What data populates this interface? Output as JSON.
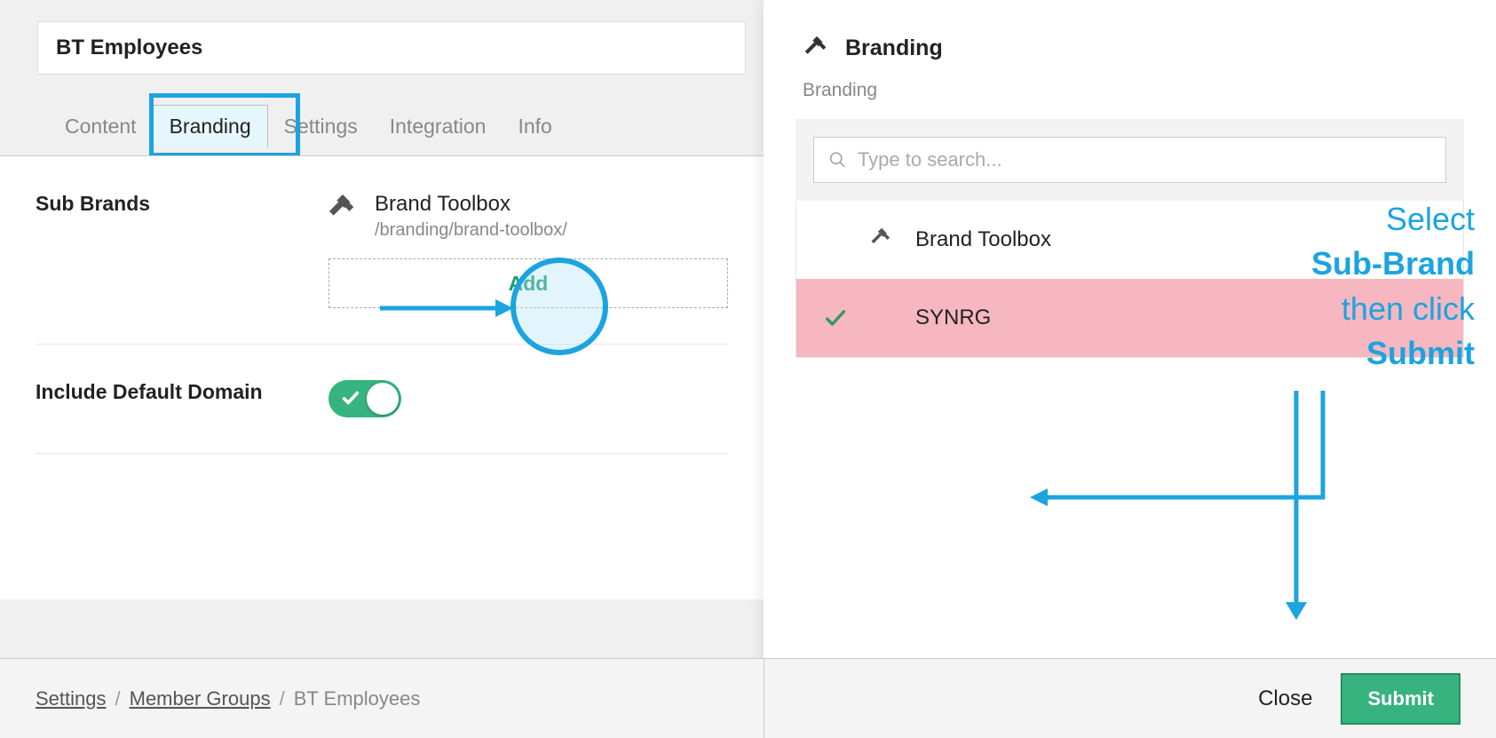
{
  "header": {
    "title_value": "BT Employees"
  },
  "tabs": {
    "content": "Content",
    "branding": "Branding",
    "settings": "Settings",
    "integration": "Integration",
    "info": "Info",
    "active": "branding"
  },
  "subbrands": {
    "label": "Sub Brands",
    "item_name": "Brand Toolbox",
    "item_path": "/branding/brand-toolbox/",
    "add_label": "Add"
  },
  "default_domain": {
    "label": "Include Default Domain",
    "value": true
  },
  "right_panel": {
    "title": "Branding",
    "subtitle": "Branding",
    "search_placeholder": "Type to search...",
    "list": [
      {
        "label": "Brand Toolbox",
        "selected": false
      },
      {
        "label": "SYNRG",
        "selected": true
      }
    ]
  },
  "annotation": {
    "line1": "Select",
    "line2": "Sub-Brand",
    "line3": "then click",
    "line4": "Submit"
  },
  "footer": {
    "crumbs": {
      "settings": "Settings",
      "member_groups": "Member Groups",
      "current": "BT Employees"
    },
    "close": "Close",
    "submit": "Submit"
  },
  "colors": {
    "accent_blue": "#1ba4e0",
    "green": "#36b37e",
    "pink": "#f6b7c1"
  }
}
